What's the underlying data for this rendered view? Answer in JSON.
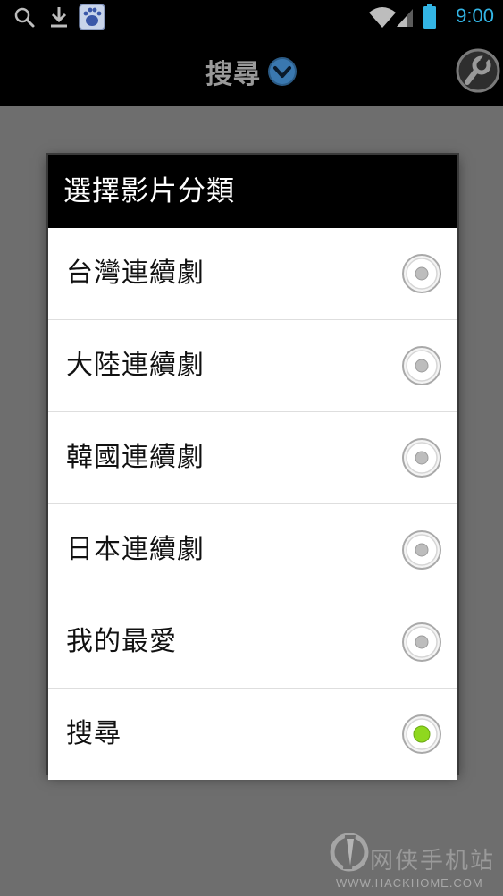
{
  "status_bar": {
    "time": "9:00",
    "icons": [
      "search-icon",
      "download-icon",
      "baidu-app-icon",
      "wifi-icon",
      "cell-signal-icon",
      "battery-icon"
    ]
  },
  "action_bar": {
    "title": "搜尋",
    "dropdown_icon": "chevron-down-icon",
    "tool_icon": "wrench-icon"
  },
  "dialog": {
    "title": "選擇影片分類",
    "options": [
      {
        "label": "台灣連續劇",
        "selected": false
      },
      {
        "label": "大陸連續劇",
        "selected": false
      },
      {
        "label": "韓國連續劇",
        "selected": false
      },
      {
        "label": "日本連續劇",
        "selected": false
      },
      {
        "label": "我的最愛",
        "selected": false
      },
      {
        "label": "搜尋",
        "selected": true
      }
    ]
  },
  "watermark": {
    "text": "网侠手机站",
    "url": "WWW.HACKHOME.COM"
  },
  "colors": {
    "accent": "#33b5e5",
    "radio_selected": "#8fd81e",
    "overlay": "#6e6e6e"
  }
}
